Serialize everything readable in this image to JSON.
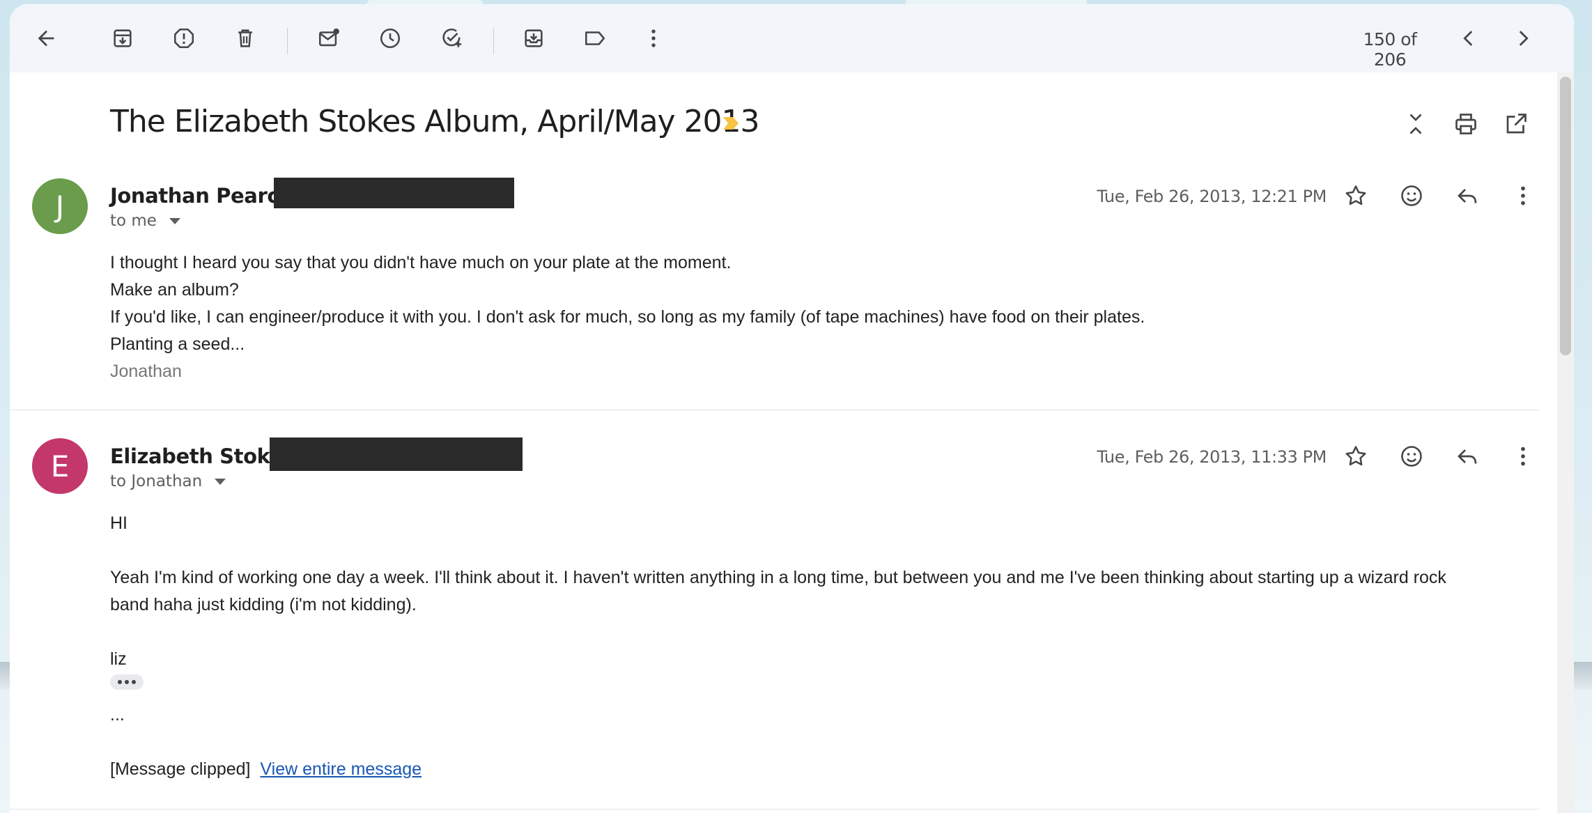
{
  "toolbar": {
    "counter": "150 of 206"
  },
  "thread": {
    "subject": "The Elizabeth Stokes Album, April/May 2013",
    "accent_color": "#f6c343"
  },
  "messages": [
    {
      "avatar_letter": "J",
      "avatar_color": "#6a9c4c",
      "sender": "Jonathan Pearce",
      "recipient": "to me",
      "date": "Tue, Feb 26, 2013, 12:21 PM",
      "lines": [
        "I thought I heard you say that you didn't have much on your plate at the moment.",
        "Make an album?",
        "If you'd like, I can engineer/produce it with you. I don't ask for much, so long as my family (of tape machines) have food on their plates.",
        "Planting a seed..."
      ],
      "signature": "Jonathan"
    },
    {
      "avatar_letter": "E",
      "avatar_color": "#c4376a",
      "sender": "Elizabeth Stokes",
      "recipient": "to Jonathan",
      "date": "Tue, Feb 26, 2013, 11:33 PM",
      "lines": [
        "HI",
        "Yeah I'm kind of working one day a week. I'll think about it. I haven't written anything in a long time, but between you and me I've been thinking about starting up a wizard rock",
        "band haha just kidding (i'm not kidding).",
        "liz",
        "..."
      ],
      "clipped_text": "[Message clipped]",
      "view_link": "View entire message"
    }
  ]
}
